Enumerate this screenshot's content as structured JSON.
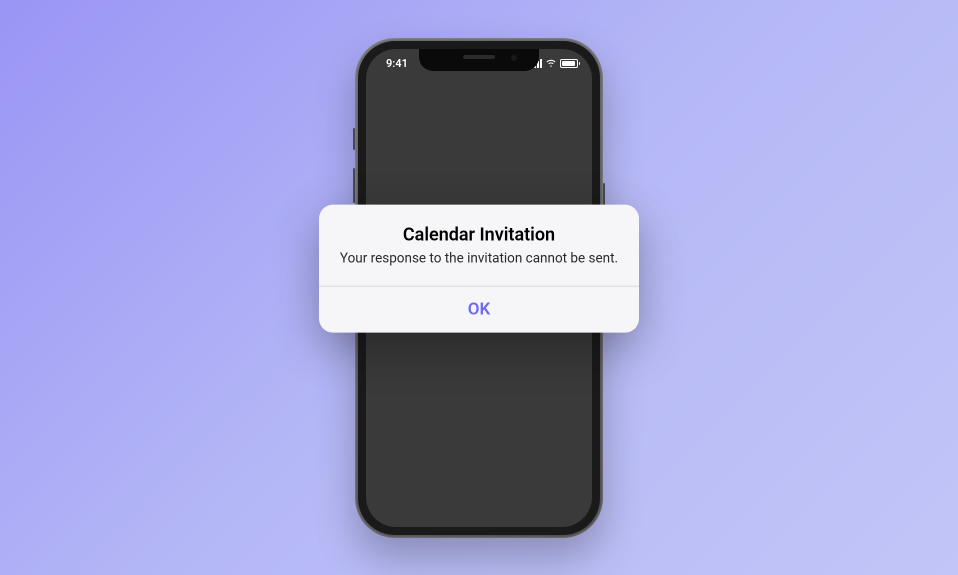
{
  "status_bar": {
    "time": "9:41"
  },
  "alert": {
    "title": "Calendar Invitation",
    "message": "Your response to the invitation cannot be sent.",
    "button_label": "OK"
  }
}
